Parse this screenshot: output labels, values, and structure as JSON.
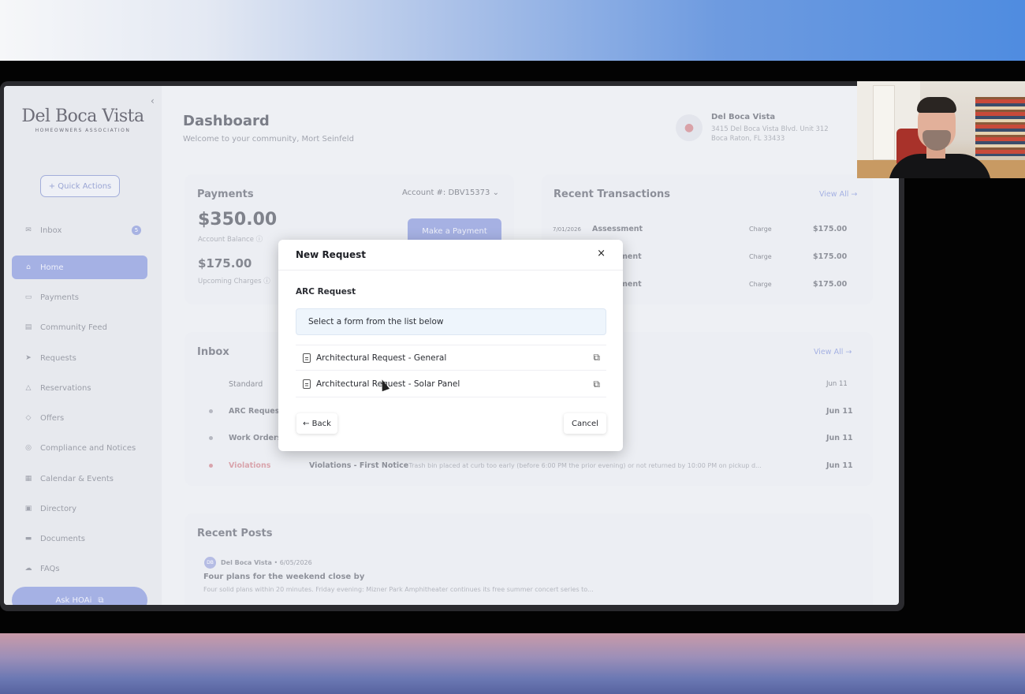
{
  "sidebar": {
    "logo_main": "Del Boca Vista",
    "logo_sub": "HOMEOWNERS ASSOCIATION",
    "quick_actions": "+ Quick Actions",
    "items": [
      {
        "label": "Inbox",
        "icon": "mail-icon",
        "badge": "5"
      },
      {
        "label": "Home",
        "icon": "home-icon"
      },
      {
        "label": "Payments",
        "icon": "credit-card-icon"
      },
      {
        "label": "Community Feed",
        "icon": "feed-icon"
      },
      {
        "label": "Requests",
        "icon": "send-icon"
      },
      {
        "label": "Reservations",
        "icon": "tent-icon"
      },
      {
        "label": "Offers",
        "icon": "tag-icon"
      },
      {
        "label": "Compliance and Notices",
        "icon": "globe-icon"
      },
      {
        "label": "Calendar & Events",
        "icon": "calendar-icon"
      },
      {
        "label": "Directory",
        "icon": "book-icon"
      },
      {
        "label": "Documents",
        "icon": "folder-icon"
      },
      {
        "label": "FAQs",
        "icon": "help-icon"
      }
    ],
    "ask": "Ask HOAi"
  },
  "header": {
    "title": "Dashboard",
    "subtitle": "Welcome to your community, Mort Seinfeld"
  },
  "property": {
    "name": "Del Boca Vista",
    "address1": "3415 Del Boca Vista Blvd. Unit 312",
    "address2": "Boca Raton, FL 33433"
  },
  "payments": {
    "title": "Payments",
    "account": "Account #: DBV15373",
    "balance": "$350.00",
    "balance_label": "Account Balance",
    "upcoming": "$175.00",
    "upcoming_label": "Upcoming Charges",
    "make_payment": "Make a Payment"
  },
  "transactions": {
    "title": "Recent Transactions",
    "view_all": "View All →",
    "rows": [
      {
        "date": "7/01/2026",
        "name": "Assessment",
        "type": "Charge",
        "amount": "$175.00"
      },
      {
        "date": "",
        "name": "ment",
        "type": "Charge",
        "amount": "$175.00"
      },
      {
        "date": "",
        "name": "ment",
        "type": "Charge",
        "amount": "$175.00"
      }
    ]
  },
  "inbox": {
    "title": "Inbox",
    "view_all": "View All →",
    "rows": [
      {
        "category": "Standard",
        "subject": "",
        "date": "Jun 11"
      },
      {
        "category": "ARC Requests",
        "subject": "",
        "date": "Jun 11"
      },
      {
        "category": "Work Orders",
        "subject": "",
        "date": "Jun 11"
      },
      {
        "category": "Violations",
        "subject": "Violations - First Notice",
        "preview": "- Trash bin placed at curb too early (before 6:00 PM the prior evening) or not returned by 10:00 PM on pickup d...",
        "date": "Jun 11"
      }
    ]
  },
  "posts": {
    "title": "Recent Posts",
    "author_initials": "DB",
    "author": "Del Boca Vista",
    "date": "6/05/2026",
    "post_title": "Four plans for the weekend close by",
    "post_preview": "Four solid plans within 20 minutes. Friday evening: Mizner Park Amphitheater continues its free summer concert series to..."
  },
  "modal": {
    "title": "New Request",
    "close": "×",
    "section": "ARC Request",
    "info": "Select a form from the list below",
    "forms": [
      {
        "label": "Architectural Request - General"
      },
      {
        "label": "Architectural Request - Solar Panel"
      }
    ],
    "back": "← Back",
    "cancel": "Cancel"
  }
}
